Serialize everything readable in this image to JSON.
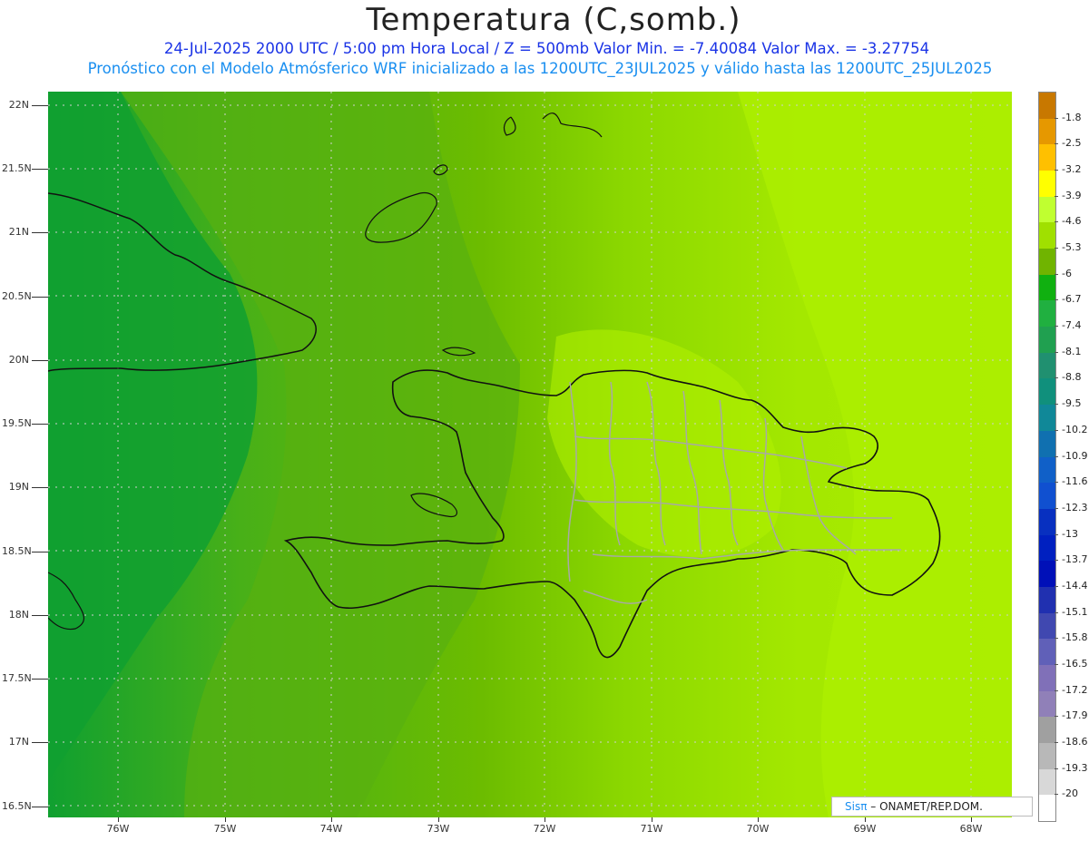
{
  "header": {
    "title": "Temperatura (C,somb.)",
    "line1": "24-Jul-2025   2000 UTC / 5:00 pm Hora Local / Z = 500mb  Valor Min. = -7.40084  Valor Max. = -3.27754",
    "line2": "Pronóstico con el Modelo Atmósferico WRF inicializado a las 1200UTC_23JUL2025 y válido hasta las  1200UTC_25JUL2025"
  },
  "map": {
    "lat_labels": [
      "22N",
      "21.5N",
      "21N",
      "20.5N",
      "20N",
      "19.5N",
      "19N",
      "18.5N",
      "18N",
      "17.5N",
      "17N",
      "16.5N"
    ],
    "lon_labels": [
      "76W",
      "75W",
      "74W",
      "73W",
      "72W",
      "71W",
      "70W",
      "69W",
      "68W"
    ]
  },
  "legend": {
    "labels": [
      "-1.8",
      "-2.5",
      "-3.2",
      "-3.9",
      "-4.6",
      "-5.3",
      "-6",
      "-6.7",
      "-7.4",
      "-8.1",
      "-8.8",
      "-9.5",
      "-10.2",
      "-10.9",
      "-11.6",
      "-12.3",
      "-13",
      "-13.7",
      "-14.4",
      "-15.1",
      "-15.8",
      "-16.5",
      "-17.2",
      "-17.9",
      "-18.6",
      "-19.3",
      "-20"
    ],
    "colors": [
      "#c87800",
      "#e69800",
      "#ffc000",
      "#ffff00",
      "#c0ff30",
      "#a0e000",
      "#70b400",
      "#10b010",
      "#20b040",
      "#20a050",
      "#209070",
      "#10907c",
      "#108898",
      "#1070b0",
      "#1060c8",
      "#1050d0",
      "#0830c0",
      "#0020c0",
      "#0010b8",
      "#2030b0",
      "#4048b0",
      "#6060b8",
      "#8070b8",
      "#9080b8",
      "#a0a0a0",
      "#b8b8b8",
      "#d8d8d8",
      "#ffffff"
    ]
  },
  "credit": {
    "brand": "Sisπ",
    "text": "– ONAMET/REP.DOM."
  }
}
